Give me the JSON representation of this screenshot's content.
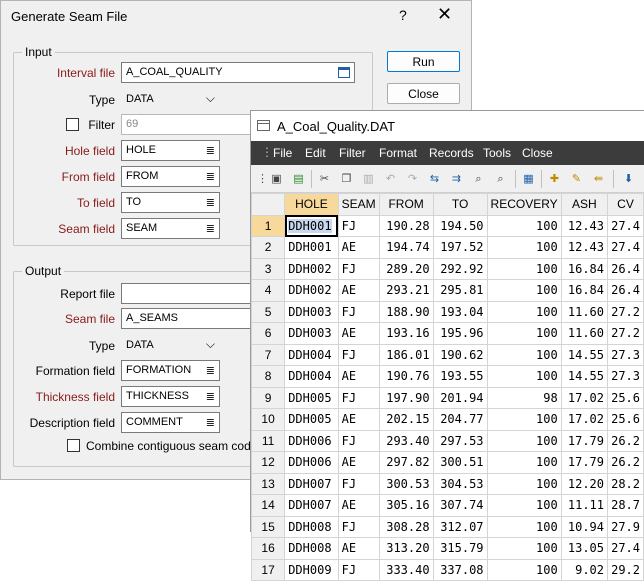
{
  "dialog": {
    "title": "Generate Seam File",
    "help_label": "?",
    "close_label": "✕",
    "input_group": "Input",
    "output_group": "Output",
    "run_label": "Run",
    "close_button_label": "Close",
    "interval_file_label": "Interval file",
    "interval_file_value": "A_COAL_QUALITY",
    "type_label": "Type",
    "type_value": "DATA",
    "filter_label": "Filter",
    "filter_value": "69",
    "hole_field_label": "Hole field",
    "hole_field_value": "HOLE",
    "from_field_label": "From field",
    "from_field_value": "FROM",
    "to_field_label": "To field",
    "to_field_value": "TO",
    "seam_field_label": "Seam field",
    "seam_field_value": "SEAM",
    "report_file_label": "Report file",
    "report_file_value": "",
    "seam_file_label": "Seam file",
    "seam_file_value": "A_SEAMS",
    "out_type_label": "Type",
    "out_type_value": "DATA",
    "formation_field_label": "Formation field",
    "formation_field_value": "FORMATION",
    "thickness_field_label": "Thickness field",
    "thickness_field_value": "THICKNESS",
    "description_field_label": "Description field",
    "description_field_value": "COMMENT",
    "combine_label": "Combine contiguous seam codes",
    "list_icon": "≣",
    "combo_icon": "⌵"
  },
  "grid_window": {
    "title": "A_Coal_Quality.DAT",
    "menu": [
      "File",
      "Edit",
      "Filter",
      "Format",
      "Records",
      "Tools",
      "Close"
    ],
    "columns": [
      "HOLE",
      "SEAM",
      "FROM",
      "TO",
      "RECOVERY",
      "ASH",
      "CV"
    ],
    "rows": [
      [
        "1",
        "DDH001",
        "FJ",
        "190.28",
        "194.50",
        "100",
        "12.43",
        "27.4"
      ],
      [
        "2",
        "DDH001",
        "AE",
        "194.74",
        "197.52",
        "100",
        "12.43",
        "27.4"
      ],
      [
        "3",
        "DDH002",
        "FJ",
        "289.20",
        "292.92",
        "100",
        "16.84",
        "26.4"
      ],
      [
        "4",
        "DDH002",
        "AE",
        "293.21",
        "295.81",
        "100",
        "16.84",
        "26.4"
      ],
      [
        "5",
        "DDH003",
        "FJ",
        "188.90",
        "193.04",
        "100",
        "11.60",
        "27.2"
      ],
      [
        "6",
        "DDH003",
        "AE",
        "193.16",
        "195.96",
        "100",
        "11.60",
        "27.2"
      ],
      [
        "7",
        "DDH004",
        "FJ",
        "186.01",
        "190.62",
        "100",
        "14.55",
        "27.3"
      ],
      [
        "8",
        "DDH004",
        "AE",
        "190.76",
        "193.55",
        "100",
        "14.55",
        "27.3"
      ],
      [
        "9",
        "DDH005",
        "FJ",
        "197.90",
        "201.94",
        "98",
        "17.02",
        "25.6"
      ],
      [
        "10",
        "DDH005",
        "AE",
        "202.15",
        "204.77",
        "100",
        "17.02",
        "25.6"
      ],
      [
        "11",
        "DDH006",
        "FJ",
        "293.40",
        "297.53",
        "100",
        "17.79",
        "26.2"
      ],
      [
        "12",
        "DDH006",
        "AE",
        "297.82",
        "300.51",
        "100",
        "17.79",
        "26.2"
      ],
      [
        "13",
        "DDH007",
        "FJ",
        "300.53",
        "304.53",
        "100",
        "12.20",
        "28.2"
      ],
      [
        "14",
        "DDH007",
        "AE",
        "305.16",
        "307.74",
        "100",
        "11.11",
        "28.7"
      ],
      [
        "15",
        "DDH008",
        "FJ",
        "308.28",
        "312.07",
        "100",
        "10.94",
        "27.9"
      ],
      [
        "16",
        "DDH008",
        "AE",
        "313.20",
        "315.79",
        "100",
        "13.05",
        "27.4"
      ],
      [
        "17",
        "DDH009",
        "FJ",
        "333.40",
        "337.08",
        "100",
        "9.02",
        "29.2"
      ]
    ]
  }
}
